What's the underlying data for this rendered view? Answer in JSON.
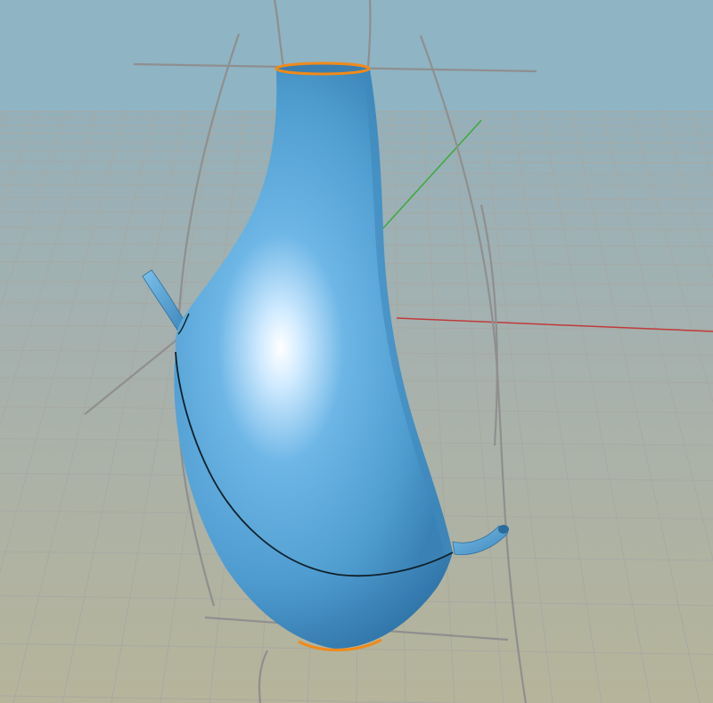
{
  "viewport": {
    "type": "3d-perspective-viewport",
    "background_top_color": "#8cb0c0",
    "background_bottom_color": "#b6b49a",
    "grid_color": "#a7a9a3",
    "x_axis_color": "#c03a3a",
    "y_axis_color": "#3aaa3a"
  },
  "model": {
    "object": "vase",
    "surface_color": "#5aa7d6",
    "highlight_color": "#ffffff",
    "seam_color": "#10202a",
    "selected_edge_color": "#f08a1a",
    "spout_count": 2
  },
  "construction_curves": {
    "color": "#8f8f8f",
    "count": 6
  }
}
